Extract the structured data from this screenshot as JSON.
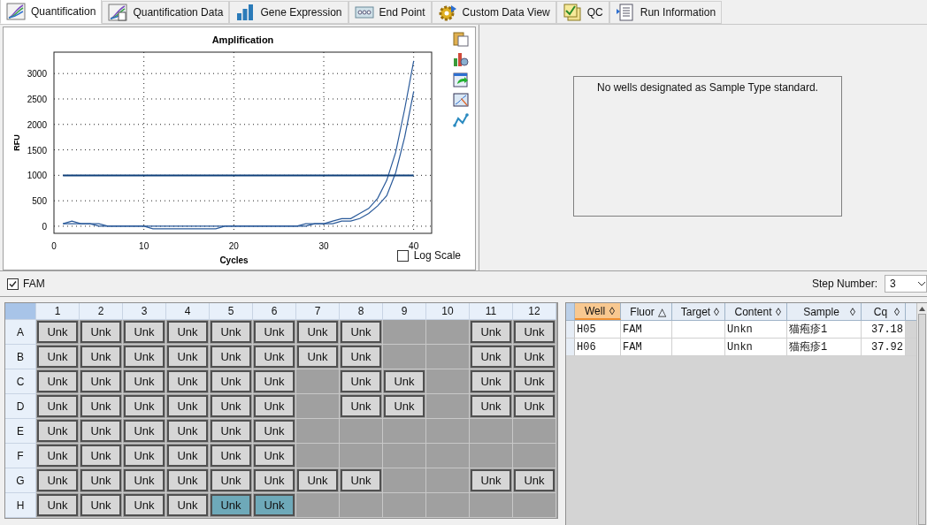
{
  "tabs": [
    {
      "label": "Quantification",
      "selected": true
    },
    {
      "label": "Quantification Data",
      "selected": false
    },
    {
      "label": "Gene Expression",
      "selected": false
    },
    {
      "label": "End Point",
      "selected": false
    },
    {
      "label": "Custom Data View",
      "selected": false
    },
    {
      "label": "QC",
      "selected": false
    },
    {
      "label": "Run Information",
      "selected": false
    }
  ],
  "chart": {
    "chart_data": {
      "type": "line",
      "title": "Amplification",
      "xlabel": "Cycles",
      "ylabel": "RFU",
      "x": [
        1,
        2,
        3,
        4,
        5,
        6,
        7,
        8,
        9,
        10,
        11,
        12,
        13,
        14,
        15,
        16,
        17,
        18,
        19,
        20,
        21,
        22,
        23,
        24,
        25,
        26,
        27,
        28,
        29,
        30,
        31,
        32,
        33,
        34,
        35,
        36,
        37,
        38,
        39,
        40
      ],
      "xlim": [
        0,
        42
      ],
      "ylim": [
        -140,
        3420
      ],
      "xticks": [
        0,
        10,
        20,
        30,
        40
      ],
      "yticks": [
        0,
        500,
        1000,
        1500,
        2000,
        2500,
        3000
      ],
      "grid": true,
      "series": [
        {
          "color": "#2a5a9a",
          "values": [
            50,
            100,
            50,
            50,
            50,
            0,
            0,
            0,
            0,
            0,
            0,
            0,
            0,
            0,
            0,
            0,
            0,
            0,
            0,
            0,
            0,
            0,
            0,
            0,
            0,
            0,
            0,
            50,
            50,
            50,
            100,
            150,
            150,
            250,
            350,
            550,
            900,
            1450,
            2300,
            3250
          ]
        },
        {
          "color": "#2a5a9a",
          "values": [
            50,
            50,
            50,
            50,
            0,
            0,
            0,
            0,
            0,
            0,
            -50,
            -50,
            -50,
            -50,
            -50,
            -50,
            -50,
            -50,
            0,
            0,
            0,
            0,
            0,
            0,
            0,
            0,
            0,
            0,
            50,
            50,
            50,
            100,
            100,
            150,
            250,
            400,
            600,
            1050,
            1750,
            2650
          ]
        },
        {
          "color": "#0d3f7a",
          "values": [
            1000,
            1000,
            1000,
            1000,
            1000,
            1000,
            1000,
            1000,
            1000,
            1000,
            1000,
            1000,
            1000,
            1000,
            1000,
            1000,
            1000,
            1000,
            1000,
            1000,
            1000,
            1000,
            1000,
            1000,
            1000,
            1000,
            1000,
            1000,
            1000,
            1000,
            1000,
            1000,
            1000,
            1000,
            1000,
            1000,
            1000,
            1000,
            1000,
            1000
          ]
        }
      ]
    },
    "log_scale": {
      "label": "Log Scale",
      "checked": false
    }
  },
  "standard_curve": {
    "message": "No wells designated as Sample Type standard."
  },
  "fluor_filter": {
    "label": "FAM",
    "checked": true
  },
  "step_number": {
    "label": "Step Number:",
    "value": "3"
  },
  "plate": {
    "columns": [
      "1",
      "2",
      "3",
      "4",
      "5",
      "6",
      "7",
      "8",
      "9",
      "10",
      "11",
      "12"
    ],
    "rows": [
      {
        "label": "A",
        "wells": [
          {
            "kind": "well",
            "label": "Unk",
            "selected": false
          },
          {
            "kind": "well",
            "label": "Unk",
            "selected": false
          },
          {
            "kind": "well",
            "label": "Unk",
            "selected": false
          },
          {
            "kind": "well",
            "label": "Unk",
            "selected": false
          },
          {
            "kind": "well",
            "label": "Unk",
            "selected": false
          },
          {
            "kind": "well",
            "label": "Unk",
            "selected": false
          },
          {
            "kind": "well",
            "label": "Unk",
            "selected": false
          },
          {
            "kind": "well",
            "label": "Unk",
            "selected": false
          },
          {
            "kind": "empty"
          },
          {
            "kind": "empty"
          },
          {
            "kind": "well",
            "label": "Unk",
            "selected": false
          },
          {
            "kind": "well",
            "label": "Unk",
            "selected": false
          }
        ]
      },
      {
        "label": "B",
        "wells": [
          {
            "kind": "well",
            "label": "Unk",
            "selected": false
          },
          {
            "kind": "well",
            "label": "Unk",
            "selected": false
          },
          {
            "kind": "well",
            "label": "Unk",
            "selected": false
          },
          {
            "kind": "well",
            "label": "Unk",
            "selected": false
          },
          {
            "kind": "well",
            "label": "Unk",
            "selected": false
          },
          {
            "kind": "well",
            "label": "Unk",
            "selected": false
          },
          {
            "kind": "well",
            "label": "Unk",
            "selected": false
          },
          {
            "kind": "well",
            "label": "Unk",
            "selected": false
          },
          {
            "kind": "empty"
          },
          {
            "kind": "empty"
          },
          {
            "kind": "well",
            "label": "Unk",
            "selected": false
          },
          {
            "kind": "well",
            "label": "Unk",
            "selected": false
          }
        ]
      },
      {
        "label": "C",
        "wells": [
          {
            "kind": "well",
            "label": "Unk",
            "selected": false
          },
          {
            "kind": "well",
            "label": "Unk",
            "selected": false
          },
          {
            "kind": "well",
            "label": "Unk",
            "selected": false
          },
          {
            "kind": "well",
            "label": "Unk",
            "selected": false
          },
          {
            "kind": "well",
            "label": "Unk",
            "selected": false
          },
          {
            "kind": "well",
            "label": "Unk",
            "selected": false
          },
          {
            "kind": "empty"
          },
          {
            "kind": "well",
            "label": "Unk",
            "selected": false
          },
          {
            "kind": "well",
            "label": "Unk",
            "selected": false
          },
          {
            "kind": "empty"
          },
          {
            "kind": "well",
            "label": "Unk",
            "selected": false
          },
          {
            "kind": "well",
            "label": "Unk",
            "selected": false
          }
        ]
      },
      {
        "label": "D",
        "wells": [
          {
            "kind": "well",
            "label": "Unk",
            "selected": false
          },
          {
            "kind": "well",
            "label": "Unk",
            "selected": false
          },
          {
            "kind": "well",
            "label": "Unk",
            "selected": false
          },
          {
            "kind": "well",
            "label": "Unk",
            "selected": false
          },
          {
            "kind": "well",
            "label": "Unk",
            "selected": false
          },
          {
            "kind": "well",
            "label": "Unk",
            "selected": false
          },
          {
            "kind": "empty"
          },
          {
            "kind": "well",
            "label": "Unk",
            "selected": false
          },
          {
            "kind": "well",
            "label": "Unk",
            "selected": false
          },
          {
            "kind": "empty"
          },
          {
            "kind": "well",
            "label": "Unk",
            "selected": false
          },
          {
            "kind": "well",
            "label": "Unk",
            "selected": false
          }
        ]
      },
      {
        "label": "E",
        "wells": [
          {
            "kind": "well",
            "label": "Unk",
            "selected": false
          },
          {
            "kind": "well",
            "label": "Unk",
            "selected": false
          },
          {
            "kind": "well",
            "label": "Unk",
            "selected": false
          },
          {
            "kind": "well",
            "label": "Unk",
            "selected": false
          },
          {
            "kind": "well",
            "label": "Unk",
            "selected": false
          },
          {
            "kind": "well",
            "label": "Unk",
            "selected": false
          },
          {
            "kind": "empty"
          },
          {
            "kind": "empty"
          },
          {
            "kind": "empty"
          },
          {
            "kind": "empty"
          },
          {
            "kind": "empty"
          },
          {
            "kind": "empty"
          }
        ]
      },
      {
        "label": "F",
        "wells": [
          {
            "kind": "well",
            "label": "Unk",
            "selected": false
          },
          {
            "kind": "well",
            "label": "Unk",
            "selected": false
          },
          {
            "kind": "well",
            "label": "Unk",
            "selected": false
          },
          {
            "kind": "well",
            "label": "Unk",
            "selected": false
          },
          {
            "kind": "well",
            "label": "Unk",
            "selected": false
          },
          {
            "kind": "well",
            "label": "Unk",
            "selected": false
          },
          {
            "kind": "empty"
          },
          {
            "kind": "empty"
          },
          {
            "kind": "empty"
          },
          {
            "kind": "empty"
          },
          {
            "kind": "empty"
          },
          {
            "kind": "empty"
          }
        ]
      },
      {
        "label": "G",
        "wells": [
          {
            "kind": "well",
            "label": "Unk",
            "selected": false
          },
          {
            "kind": "well",
            "label": "Unk",
            "selected": false
          },
          {
            "kind": "well",
            "label": "Unk",
            "selected": false
          },
          {
            "kind": "well",
            "label": "Unk",
            "selected": false
          },
          {
            "kind": "well",
            "label": "Unk",
            "selected": false
          },
          {
            "kind": "well",
            "label": "Unk",
            "selected": false
          },
          {
            "kind": "well",
            "label": "Unk",
            "selected": false
          },
          {
            "kind": "well",
            "label": "Unk",
            "selected": false
          },
          {
            "kind": "empty"
          },
          {
            "kind": "empty"
          },
          {
            "kind": "well",
            "label": "Unk",
            "selected": false
          },
          {
            "kind": "well",
            "label": "Unk",
            "selected": false
          }
        ]
      },
      {
        "label": "H",
        "wells": [
          {
            "kind": "well",
            "label": "Unk",
            "selected": false
          },
          {
            "kind": "well",
            "label": "Unk",
            "selected": false
          },
          {
            "kind": "well",
            "label": "Unk",
            "selected": false
          },
          {
            "kind": "well",
            "label": "Unk",
            "selected": false
          },
          {
            "kind": "well",
            "label": "Unk",
            "selected": true
          },
          {
            "kind": "well",
            "label": "Unk",
            "selected": true
          },
          {
            "kind": "empty"
          },
          {
            "kind": "empty"
          },
          {
            "kind": "empty"
          },
          {
            "kind": "empty"
          },
          {
            "kind": "empty"
          },
          {
            "kind": "empty"
          }
        ]
      }
    ]
  },
  "table": {
    "columns": [
      {
        "label": "Well",
        "sort": "◊",
        "selected": true
      },
      {
        "label": "Fluor",
        "sort": "△",
        "selected": false
      },
      {
        "label": "Target",
        "sort": "◊",
        "selected": false
      },
      {
        "label": "Content",
        "sort": "◊",
        "selected": false
      },
      {
        "label": "Sample",
        "sort": "◊",
        "selected": false
      },
      {
        "label": "Cq",
        "sort": "◊",
        "selected": false
      }
    ],
    "rows": [
      [
        "H05",
        "FAM",
        "",
        "Unkn",
        "猫疱疹1",
        "37.18"
      ],
      [
        "H06",
        "FAM",
        "",
        "Unkn",
        "猫疱疹1",
        "37.92"
      ]
    ]
  }
}
